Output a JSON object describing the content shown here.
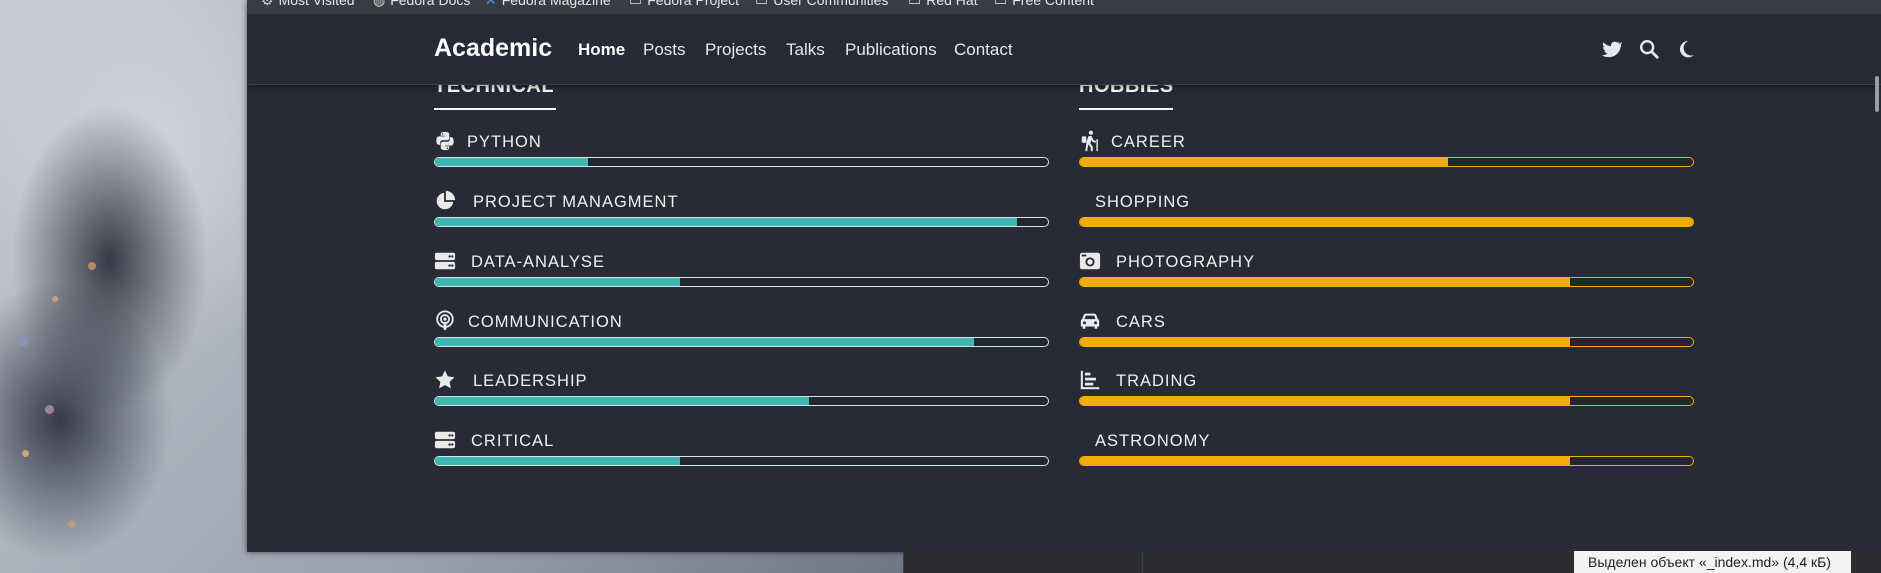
{
  "bookmarks": [
    {
      "icon": "gear-icon",
      "label": "Most Visited"
    },
    {
      "icon": "globe-icon",
      "label": "Fedora Docs"
    },
    {
      "icon": "fedora-icon",
      "label": "Fedora Magazine"
    },
    {
      "icon": "folder-icon",
      "label": "Fedora Project"
    },
    {
      "icon": "folder-icon",
      "label": "User Communities"
    },
    {
      "icon": "folder-icon",
      "label": "Red Hat"
    },
    {
      "icon": "folder-icon",
      "label": "Free Content"
    }
  ],
  "navbar": {
    "brand": "Academic",
    "links": [
      "Home",
      "Posts",
      "Projects",
      "Talks",
      "Publications",
      "Contact"
    ],
    "active": "Home",
    "icons": [
      "twitter-icon",
      "search-icon",
      "moon-icon"
    ]
  },
  "technical": {
    "title": "TECHNICAL",
    "color": "#3fb8b4",
    "skills": [
      {
        "label": "PYTHON",
        "icon": "python-icon",
        "percent": 25
      },
      {
        "label": "PROJECT MANAGMENT",
        "icon": "pie-chart-icon",
        "percent": 95
      },
      {
        "label": "DATA-ANALYSE",
        "icon": "server-icon",
        "percent": 40
      },
      {
        "label": "COMMUNICATION",
        "icon": "podcast-icon",
        "percent": 88
      },
      {
        "label": "LEADERSHIP",
        "icon": "star-icon",
        "percent": 61
      },
      {
        "label": "CRITICAL",
        "icon": "server-icon",
        "percent": 40
      }
    ]
  },
  "hobbies": {
    "title": "HOBBIES",
    "color": "#f0ae0a",
    "skills": [
      {
        "label": "CAREER",
        "icon": "hiking-icon",
        "percent": 60
      },
      {
        "label": "SHOPPING",
        "icon": "",
        "percent": 100
      },
      {
        "label": "PHOTOGRAPHY",
        "icon": "camera-retro-icon",
        "percent": 80
      },
      {
        "label": "CARS",
        "icon": "car-icon",
        "percent": 80
      },
      {
        "label": "TRADING",
        "icon": "chart-bar-icon",
        "percent": 80
      },
      {
        "label": "ASTRONOMY",
        "icon": "",
        "percent": 80
      }
    ]
  },
  "file_manager": {
    "status": "Выделен объект «_index.md» (4,4 кБ)"
  }
}
